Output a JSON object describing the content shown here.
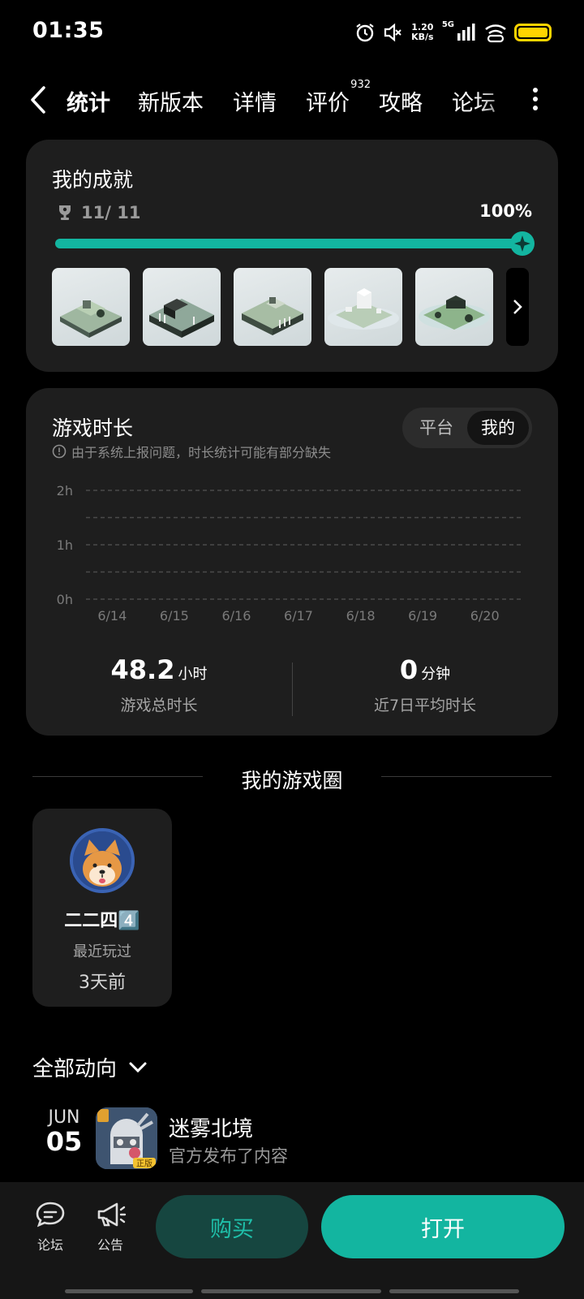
{
  "status_bar": {
    "time": "01:35",
    "net_speed_value": "1.20",
    "net_speed_unit": "KB/s",
    "network": "5G",
    "battery_color": "#ffd400"
  },
  "nav": {
    "tabs": [
      {
        "label": "统计",
        "active": true
      },
      {
        "label": "新版本"
      },
      {
        "label": "详情"
      },
      {
        "label": "评价",
        "badge": "932"
      },
      {
        "label": "攻略"
      },
      {
        "label": "论坛"
      }
    ]
  },
  "achievements": {
    "title": "我的成就",
    "count": "11/ 11",
    "percent": "100%",
    "progress": 1.0
  },
  "playtime": {
    "title": "游戏时长",
    "note": "由于系统上报问题，时长统计可能有部分缺失",
    "toggle": [
      "平台",
      "我的"
    ],
    "toggle_selected": "我的",
    "total_value": "48.2",
    "total_unit": "小时",
    "total_label": "游戏总时长",
    "avg_value": "0",
    "avg_unit": "分钟",
    "avg_label": "近7日平均时长"
  },
  "chart_data": {
    "type": "bar",
    "categories": [
      "6/14",
      "6/15",
      "6/16",
      "6/17",
      "6/18",
      "6/19",
      "6/20"
    ],
    "values": [
      0,
      0,
      0,
      0,
      0,
      0,
      0
    ],
    "y_ticks": [
      "0h",
      "1h",
      "2h"
    ],
    "ylim": [
      0,
      2
    ],
    "grid": "dashed"
  },
  "circle": {
    "section_title": "我的游戏圈",
    "name": "二二四4️⃣",
    "meta": "最近玩过",
    "when": "3天前"
  },
  "feed": {
    "header": "全部动向",
    "items": [
      {
        "month": "JUN",
        "day": "05",
        "title": "迷雾北境",
        "subtitle": "官方发布了内容",
        "badge": "正版"
      }
    ]
  },
  "bottom": {
    "forum_label": "论坛",
    "notice_label": "公告",
    "buy_label": "购买",
    "open_label": "打开",
    "accent": "#13b5a0"
  }
}
